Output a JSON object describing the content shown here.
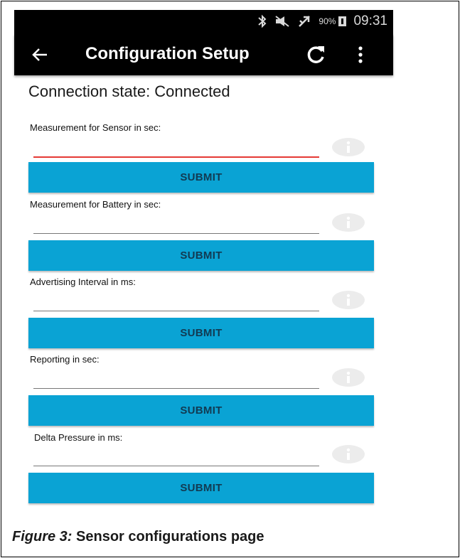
{
  "status_bar": {
    "icons": [
      "bluetooth-icon",
      "muted-icon",
      "airplane-mode-icon",
      "battery-icon"
    ],
    "battery_percent": "90%",
    "time": "09:31"
  },
  "app_bar": {
    "title": "Configuration Setup",
    "icons": [
      "back-arrow-icon",
      "refresh-icon",
      "more-vert-icon"
    ]
  },
  "connection": {
    "label": "Connection state:",
    "value": "Connected"
  },
  "fields": [
    {
      "label": "Measurement for Sensor in sec:",
      "value": "",
      "submit_label": "SUBMIT",
      "active": true
    },
    {
      "label": "Measurement for Battery in sec:",
      "value": "",
      "submit_label": "SUBMIT",
      "active": false
    },
    {
      "label": "Advertising Interval in ms:",
      "value": "",
      "submit_label": "SUBMIT",
      "active": false
    },
    {
      "label": "Reporting in sec:",
      "value": "",
      "submit_label": "SUBMIT",
      "active": false
    },
    {
      "label": "Delta Pressure in ms:",
      "value": "",
      "submit_label": "SUBMIT",
      "active": false
    }
  ],
  "colors": {
    "app_bar": "#000000",
    "submit_button": "#0aa3d4",
    "active_underline": "#e53935"
  },
  "caption": {
    "figure": "Figure 3:",
    "text": "Sensor configurations page"
  }
}
